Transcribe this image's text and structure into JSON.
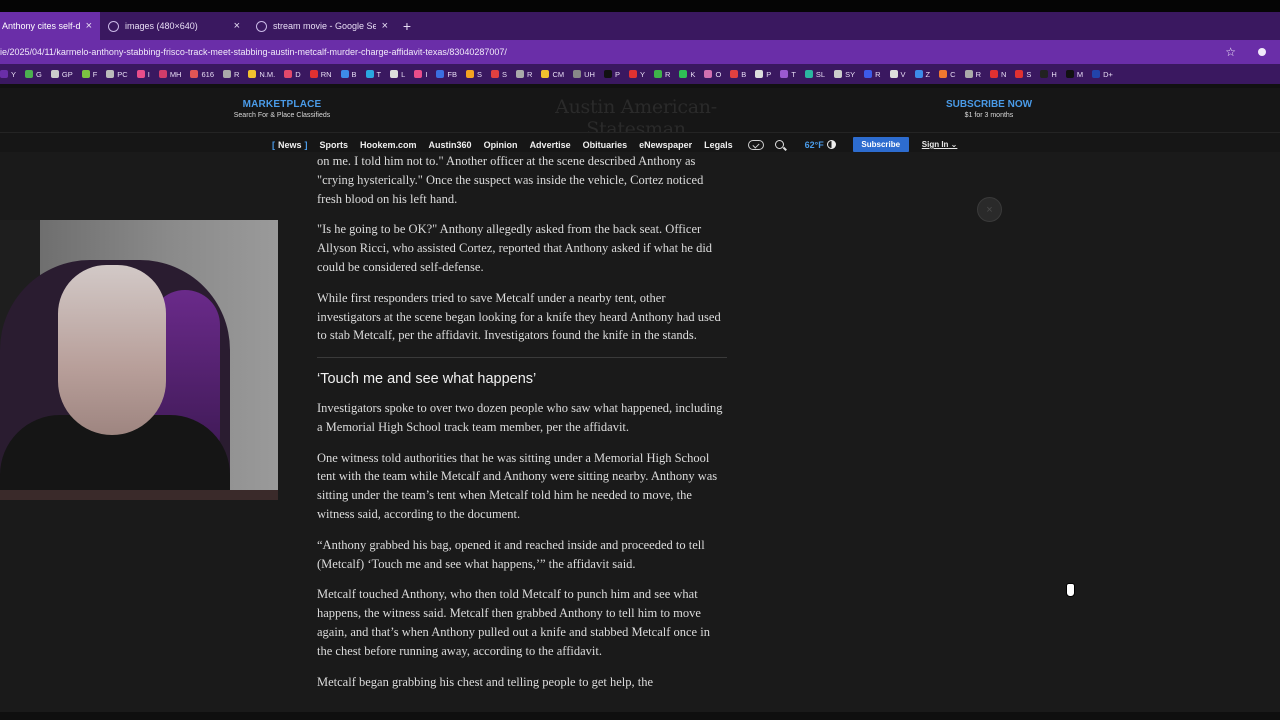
{
  "browser": {
    "tabs": [
      {
        "label": "Anthony cites self-defe",
        "active": true
      },
      {
        "label": "images (480×640)",
        "active": false
      },
      {
        "label": "stream movie - Google Search",
        "active": false
      }
    ],
    "url": "ie/2025/04/11/karmelo-anthony-stabbing-frisco-track-meet-stabbing-austin-metcalf-murder-charge-affidavit-texas/83040287007/",
    "bookmarks": [
      {
        "label": "Y",
        "color": "#6a2ea8"
      },
      {
        "label": "G",
        "color": "#4caf50"
      },
      {
        "label": "GP",
        "color": "#cccccc"
      },
      {
        "label": "F",
        "color": "#7cc242"
      },
      {
        "label": "PC",
        "color": "#bbbbbb"
      },
      {
        "label": "I",
        "color": "#e94d8a"
      },
      {
        "label": "MH",
        "color": "#d23c6a"
      },
      {
        "label": "616",
        "color": "#e25555"
      },
      {
        "label": "R",
        "color": "#aaaaaa"
      },
      {
        "label": "N.M.",
        "color": "#f2c12e"
      },
      {
        "label": "D",
        "color": "#e2496b"
      },
      {
        "label": "RN",
        "color": "#e03131"
      },
      {
        "label": "B",
        "color": "#3d8be8"
      },
      {
        "label": "T",
        "color": "#2aa7e0"
      },
      {
        "label": "L",
        "color": "#dddddd"
      },
      {
        "label": "I",
        "color": "#e94d8a"
      },
      {
        "label": "FB",
        "color": "#3b6fe0"
      },
      {
        "label": "S",
        "color": "#f4a321"
      },
      {
        "label": "S",
        "color": "#e04040"
      },
      {
        "label": "R",
        "color": "#aaaaaa"
      },
      {
        "label": "CM",
        "color": "#f2c12e"
      },
      {
        "label": "UH",
        "color": "#888888"
      },
      {
        "label": "P",
        "color": "#111111"
      },
      {
        "label": "Y",
        "color": "#e03131"
      },
      {
        "label": "R",
        "color": "#3fb24a"
      },
      {
        "label": "K",
        "color": "#2fbf56"
      },
      {
        "label": "O",
        "color": "#d26fb0"
      },
      {
        "label": "B",
        "color": "#e04040"
      },
      {
        "label": "P",
        "color": "#dddddd"
      },
      {
        "label": "T",
        "color": "#9b59d0"
      },
      {
        "label": "SL",
        "color": "#2bb5a0"
      },
      {
        "label": "SY",
        "color": "#cccccc"
      },
      {
        "label": "R",
        "color": "#3d5be8"
      },
      {
        "label": "V",
        "color": "#dddddd"
      },
      {
        "label": "Z",
        "color": "#3d8be8"
      },
      {
        "label": "C",
        "color": "#f07830"
      },
      {
        "label": "R",
        "color": "#aaaaaa"
      },
      {
        "label": "N",
        "color": "#e03131"
      },
      {
        "label": "S",
        "color": "#e03131"
      },
      {
        "label": "H",
        "color": "#222222"
      },
      {
        "label": "M",
        "color": "#111111"
      },
      {
        "label": "D+",
        "color": "#2244aa"
      }
    ]
  },
  "header": {
    "marketplace_title": "MARKETPLACE",
    "marketplace_sub": "Search For & Place Classifieds",
    "masthead": "Austin American-Statesman",
    "subscribe_title": "SUBSCRIBE NOW",
    "subscribe_sub": "$1 for 3 months"
  },
  "nav": {
    "items": [
      "News",
      "Sports",
      "Hookem.com",
      "Austin360",
      "Opinion",
      "Advertise",
      "Obituaries",
      "eNewspaper",
      "Legals"
    ],
    "temperature": "62°F",
    "subscribe_button": "Subscribe",
    "sign_in": "Sign In"
  },
  "article": {
    "p1": "on me. I told him not to.\" Another officer at the scene described Anthony as \"crying hysterically.\" Once the suspect was inside the vehicle, Cortez noticed fresh blood on his left hand.",
    "p2": "\"Is he going to be OK?\" Anthony allegedly asked from the back seat. Officer Allyson Ricci, who assisted Cortez, reported that Anthony asked if what he did could be considered self-defense.",
    "p3": "While first responders tried to save Metcalf under a nearby tent, other investigators at the scene began looking for a knife they heard Anthony had used to stab Metcalf, per the affidavit. Investigators found the knife in the stands.",
    "heading": "‘Touch me and see what happens’",
    "p4": "Investigators spoke to over two dozen people who saw what happened, including a Memorial High School track team member, per the affidavit.",
    "p5": "One witness told authorities that he was sitting under a Memorial High School tent with the team while Metcalf and Anthony were sitting nearby. Anthony was sitting under the team’s tent when Metcalf told him he needed to move, the witness said, according to the document.",
    "p6": "“Anthony grabbed his bag, opened it and reached inside and proceeded to tell (Metcalf) ‘Touch me and see what happens,’” the affidavit said.",
    "p7": "Metcalf touched Anthony, who then told Metcalf to punch him and see what happens, the witness said. Metcalf then grabbed Anthony to tell him to move again, and that’s when Anthony pulled out a knife and stabbed Metcalf once in the chest before running away, according to the affidavit.",
    "p8": "Metcalf began grabbing his chest and telling people to get help, the"
  },
  "overlay": {
    "close_glyph": "×",
    "new_tab_glyph": "+",
    "tab_close_glyph": "×",
    "star_glyph": "☆"
  }
}
